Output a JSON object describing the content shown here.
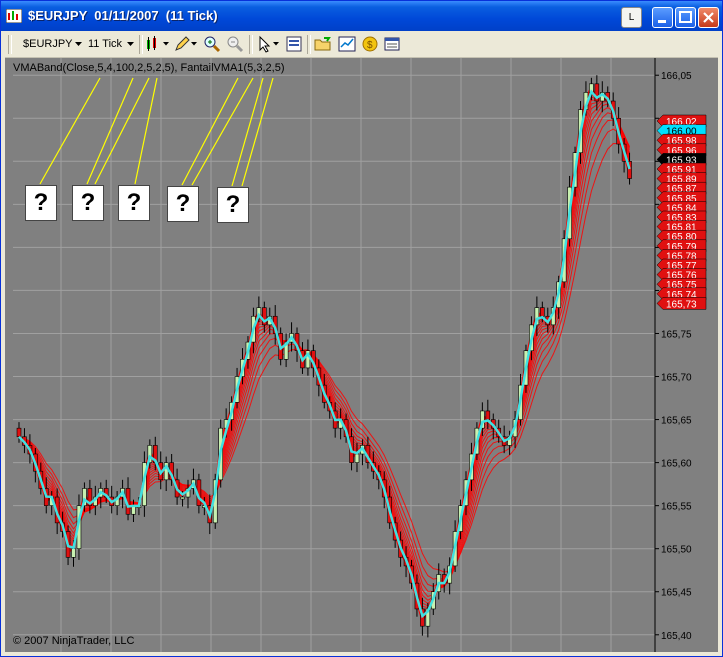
{
  "window": {
    "title": "$EURJPY  01/11/2007  (11 Tick)",
    "btn_l": "L"
  },
  "toolbar": {
    "instrument": "$EURJPY",
    "interval": "11 Tick",
    "icons": [
      "candlestick-icon",
      "pencil-draw-icon",
      "zoom-in-icon",
      "zoom-out-icon",
      "cursor-icon",
      "properties-icon",
      "open-folder-icon",
      "chart-icon",
      "coin-icon",
      "data-box-icon"
    ]
  },
  "chart": {
    "indicator_label": "VMABand(Close,5,4,100,2,5,2,5), FantailVMA1(5,3,2,5)",
    "question_marks": [
      "?",
      "?",
      "?",
      "?",
      "?"
    ],
    "copyright": "© 2007 NinjaTrader, LLC",
    "price_axis_labels": [
      "166,05",
      "166,00",
      "165,95",
      "165,90",
      "165,85",
      "165,80",
      "165,75",
      "165,70",
      "165,65",
      "165,60",
      "165,55",
      "165,50",
      "165,45",
      "165,40"
    ],
    "badges": [
      {
        "text": "166,02",
        "color": "#e01010"
      },
      {
        "text": "166,00",
        "color": "#00e0ff"
      },
      {
        "text": "165,98",
        "color": "#e01010"
      },
      {
        "text": "165,96",
        "color": "#e01010"
      },
      {
        "text": "165,93",
        "color": "#000000"
      },
      {
        "text": "165,91",
        "color": "#e01010"
      },
      {
        "text": "165,89",
        "color": "#e01010"
      },
      {
        "text": "165,87",
        "color": "#e01010"
      },
      {
        "text": "165,85",
        "color": "#e01010"
      },
      {
        "text": "165,84",
        "color": "#e01010"
      },
      {
        "text": "165,83",
        "color": "#e01010"
      },
      {
        "text": "165,81",
        "color": "#e01010"
      },
      {
        "text": "165,80",
        "color": "#e01010"
      },
      {
        "text": "165,79",
        "color": "#e01010"
      },
      {
        "text": "165,78",
        "color": "#e01010"
      },
      {
        "text": "165,77",
        "color": "#e01010"
      },
      {
        "text": "165,76",
        "color": "#e01010"
      },
      {
        "text": "165,75",
        "color": "#e01010"
      },
      {
        "text": "165,74",
        "color": "#e01010"
      },
      {
        "text": "165,73",
        "color": "#e01010"
      }
    ],
    "colors": {
      "background": "#808080",
      "grid": "#a0a0a0",
      "up": "#c8f0b0",
      "down": "#e01010",
      "fantail": "#40e0e0",
      "bands": "#ff0000",
      "annotation": "#ffff00"
    }
  },
  "chart_data": {
    "type": "candlestick",
    "ylim": [
      165.38,
      166.07
    ],
    "series_close": [
      165.63,
      165.62,
      165.61,
      165.59,
      165.57,
      165.55,
      165.56,
      165.53,
      165.52,
      165.49,
      165.5,
      165.55,
      165.57,
      165.55,
      165.56,
      165.57,
      165.56,
      165.55,
      165.56,
      165.57,
      165.54,
      165.55,
      165.55,
      165.6,
      165.62,
      165.6,
      165.58,
      165.6,
      165.58,
      165.56,
      165.56,
      165.57,
      165.58,
      165.55,
      165.55,
      165.53,
      165.58,
      165.64,
      165.65,
      165.67,
      165.7,
      165.72,
      165.74,
      165.77,
      165.78,
      165.76,
      165.77,
      165.75,
      165.72,
      165.74,
      165.75,
      165.73,
      165.71,
      165.73,
      165.71,
      165.69,
      165.67,
      165.66,
      165.64,
      165.65,
      165.63,
      165.6,
      165.61,
      165.62,
      165.6,
      165.59,
      165.58,
      165.56,
      165.53,
      165.51,
      165.49,
      165.48,
      165.46,
      165.43,
      165.41,
      165.43,
      165.45,
      165.47,
      165.46,
      165.48,
      165.52,
      165.55,
      165.58,
      165.61,
      165.64,
      165.66,
      165.65,
      165.64,
      165.63,
      165.62,
      165.63,
      165.65,
      165.69,
      165.73,
      165.76,
      165.78,
      165.77,
      165.76,
      165.78,
      165.81,
      165.86,
      165.92,
      165.96,
      166.01,
      166.03,
      166.04,
      166.02,
      166.03,
      166.02,
      166.0,
      165.97,
      165.95,
      165.93
    ]
  }
}
